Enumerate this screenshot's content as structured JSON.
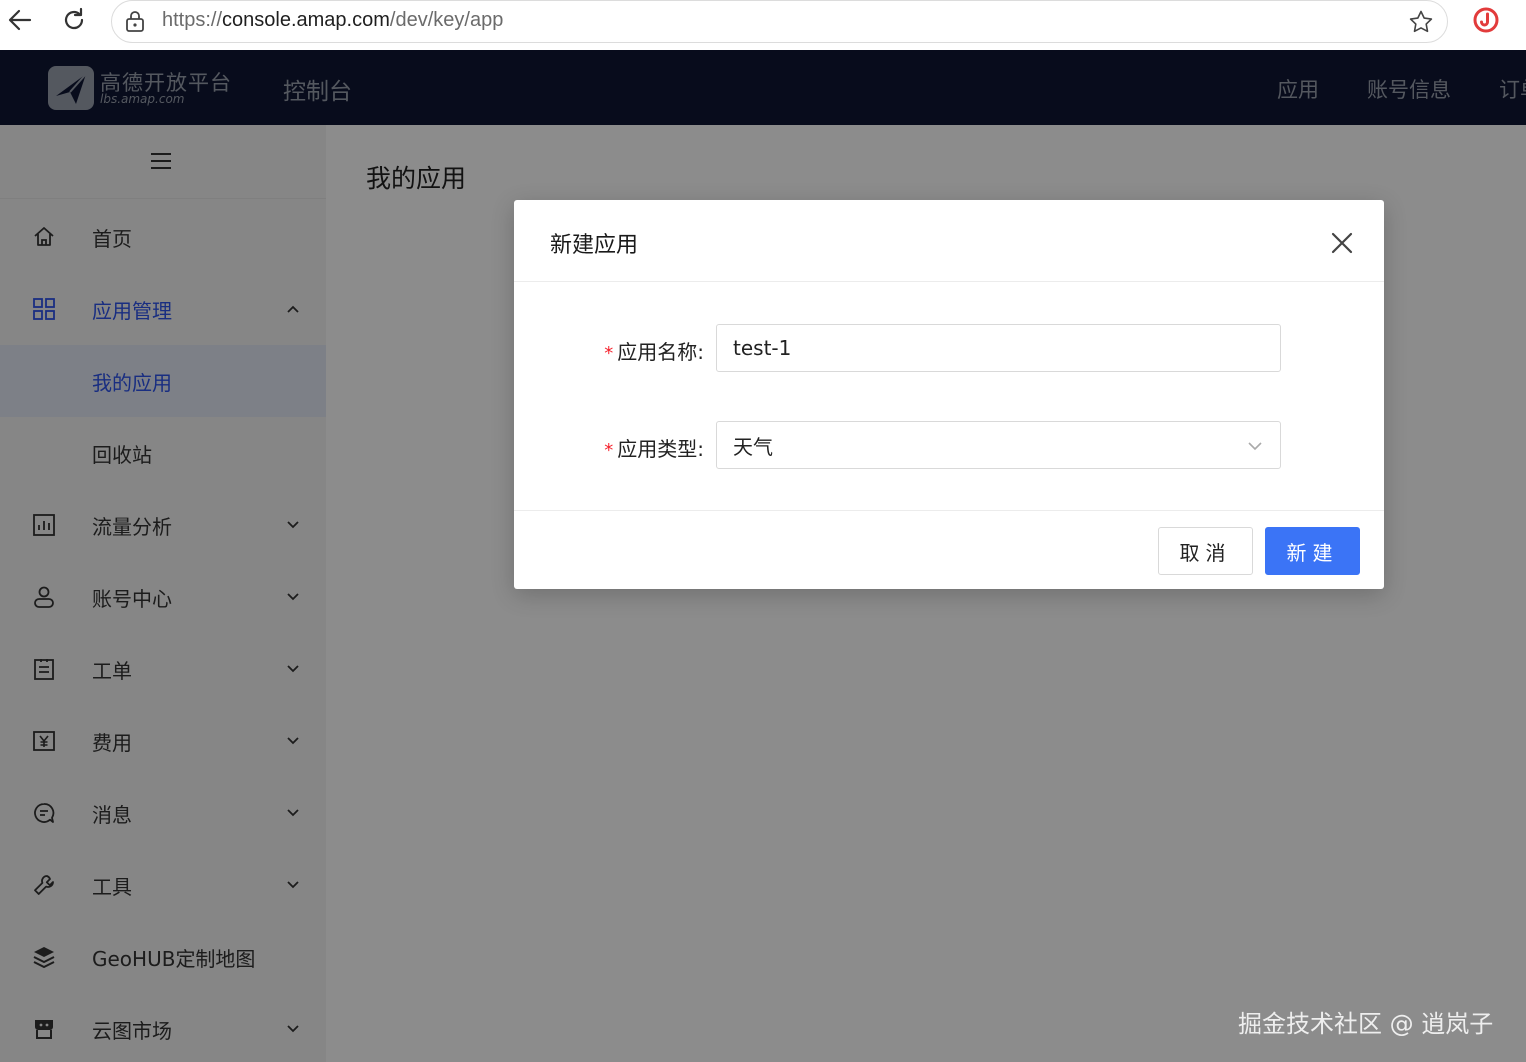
{
  "browser": {
    "url_scheme": "https://",
    "url_host": "console.amap.com",
    "url_path": "/dev/key/app"
  },
  "header": {
    "brand_cn": "高德开放平台",
    "brand_en": "lbs.amap.com",
    "console": "控制台",
    "nav": [
      "应用",
      "账号信息",
      "订单"
    ]
  },
  "sidebar": {
    "items": [
      {
        "label": "首页",
        "icon": "home-icon"
      },
      {
        "label": "应用管理",
        "icon": "app-grid-icon"
      },
      {
        "label": "我的应用"
      },
      {
        "label": "回收站"
      },
      {
        "label": "流量分析",
        "icon": "chart-icon"
      },
      {
        "label": "账号中心",
        "icon": "user-icon"
      },
      {
        "label": "工单",
        "icon": "ticket-icon"
      },
      {
        "label": "费用",
        "icon": "yuan-icon"
      },
      {
        "label": "消息",
        "icon": "message-icon"
      },
      {
        "label": "工具",
        "icon": "wrench-icon"
      },
      {
        "label": "GeoHUB定制地图",
        "icon": "layers-icon"
      },
      {
        "label": "云图市场",
        "icon": "store-icon"
      }
    ]
  },
  "main": {
    "title": "我的应用"
  },
  "modal": {
    "title": "新建应用",
    "fields": {
      "name_label": "应用名称:",
      "name_value": "test-1",
      "type_label": "应用类型:",
      "type_value": "天气",
      "required_mark": "*"
    },
    "cancel_label": "取消",
    "submit_label": "新建"
  },
  "watermark": "掘金技术社区 @ 逍岚子",
  "colors": {
    "header_bg": "#0f1733",
    "primary": "#3b74f6",
    "active_text": "#2f54eb",
    "required": "#f5222d"
  }
}
